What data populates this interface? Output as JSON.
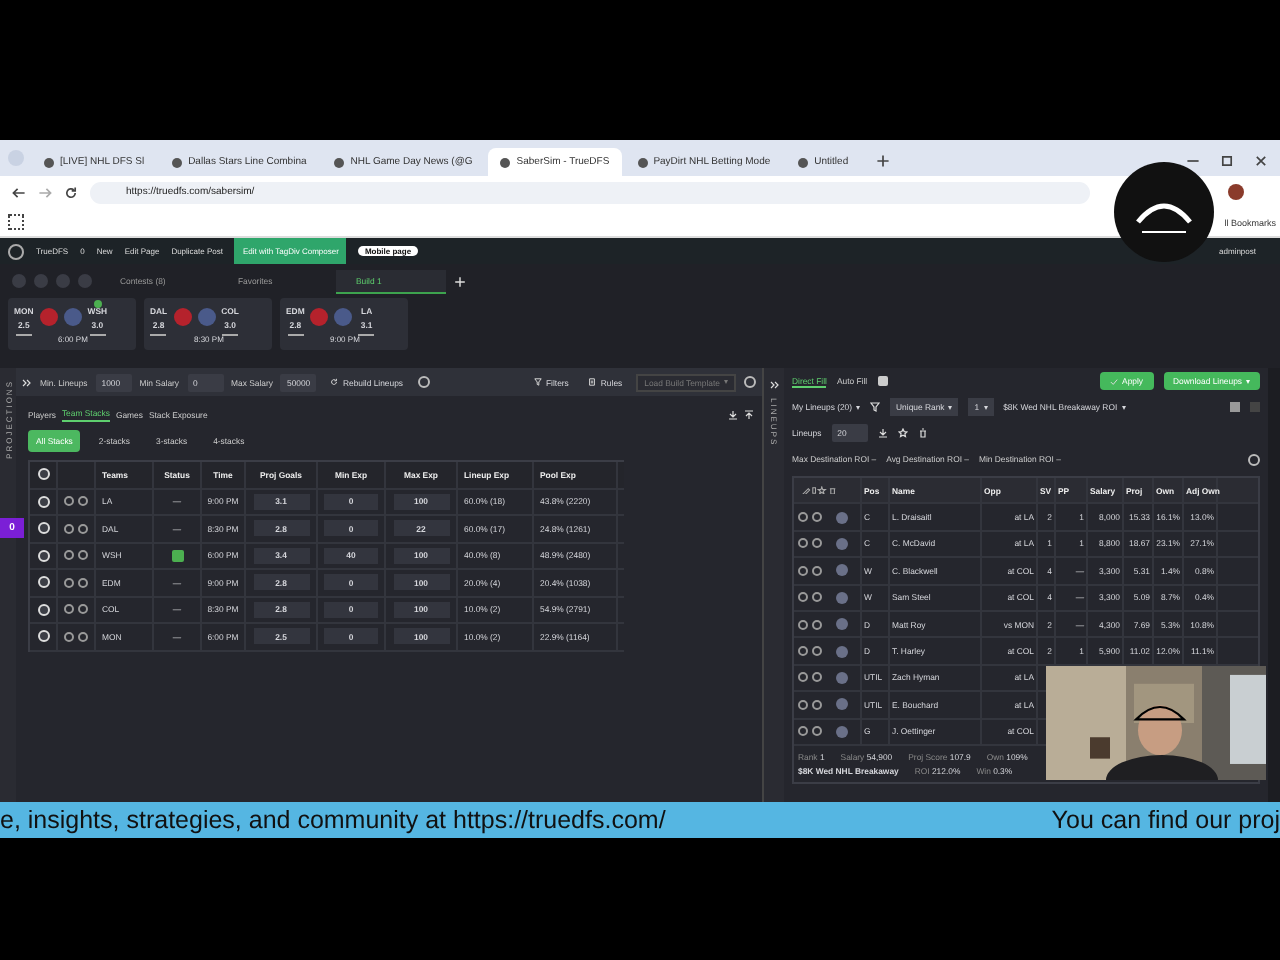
{
  "browser": {
    "tabs": [
      {
        "title": "[LIVE] NHL DFS Sl",
        "selected": false
      },
      {
        "title": "Dallas Stars Line Combina",
        "selected": false
      },
      {
        "title": "NHL Game Day News (@G",
        "selected": false
      },
      {
        "title": "SaberSim - TrueDFS",
        "selected": true
      },
      {
        "title": "PayDirt NHL Betting Mode",
        "selected": false
      },
      {
        "title": "Untitled",
        "selected": false
      }
    ],
    "url": "https://truedfs.com/sabersim/",
    "bookmarks": "ll Bookmarks"
  },
  "wp_bar": {
    "items": [
      {
        "label": "TrueDFS",
        "kind": "plain"
      },
      {
        "label": "0",
        "kind": "plain"
      },
      {
        "label": "New",
        "kind": "plain"
      },
      {
        "label": "Edit Page",
        "kind": "plain"
      },
      {
        "label": "Duplicate Post",
        "kind": "plain"
      },
      {
        "label": "Edit with TagDiv Composer",
        "kind": "composer"
      },
      {
        "label": "Mobile page",
        "kind": "mobile"
      }
    ],
    "user": "adminpost"
  },
  "app": {
    "left_rail": "PROJECTIONS",
    "right_rail": "LINEUPS",
    "side_badge": "0",
    "top_tabs": [
      {
        "label": "Contests (8)",
        "selected": false
      },
      {
        "label": "Favorites",
        "selected": false
      },
      {
        "label": "Build 1",
        "selected": true
      }
    ],
    "games": [
      {
        "away": "MON",
        "away_goals": "2.5",
        "home": "WSH",
        "home_goals": "3.0",
        "time": "6:00 PM",
        "stacked": true
      },
      {
        "away": "DAL",
        "away_goals": "2.8",
        "home": "COL",
        "home_goals": "3.0",
        "time": "8:30 PM",
        "stacked": false
      },
      {
        "away": "EDM",
        "away_goals": "2.8",
        "home": "LA",
        "home_goals": "3.1",
        "time": "9:00 PM",
        "stacked": false
      }
    ],
    "toolbar": {
      "fields": [
        {
          "label": "Min. Lineups",
          "value": "1000"
        },
        {
          "label": "Min Salary",
          "value": "0"
        },
        {
          "label": "Max Salary",
          "value": "50000"
        }
      ],
      "rebuild": "Rebuild Lineups",
      "filters": "Filters",
      "rules": "Rules",
      "template_placeholder": "Load Build Template"
    },
    "subtabs": [
      {
        "label": "Players",
        "selected": false
      },
      {
        "label": "Team Stacks",
        "selected": true
      },
      {
        "label": "Games",
        "selected": false
      },
      {
        "label": "Stack Exposure",
        "selected": false
      }
    ],
    "stack_filters": [
      {
        "label": "All Stacks",
        "selected": true
      },
      {
        "label": "2-stacks",
        "selected": false
      },
      {
        "label": "3-stacks",
        "selected": false
      },
      {
        "label": "4-stacks",
        "selected": false
      }
    ],
    "stacks": {
      "all_checked": true,
      "columns": [
        "Teams",
        "Status",
        "Time",
        "Proj Goals",
        "Min Exp",
        "Max Exp",
        "Lineup Exp",
        "Pool Exp"
      ],
      "rows": [
        {
          "checked": true,
          "team": "LA",
          "locked": false,
          "status": "—",
          "time": "9:00 PM",
          "proj_goals": "3.1",
          "min_exp": "0",
          "max_exp": "100",
          "lineup_exp": "60.0% (18)",
          "pool_exp": "43.8% (2220)"
        },
        {
          "checked": true,
          "team": "DAL",
          "locked": false,
          "status": "—",
          "time": "8:30 PM",
          "proj_goals": "2.8",
          "min_exp": "0",
          "max_exp": "22",
          "lineup_exp": "60.0% (17)",
          "pool_exp": "24.8% (1261)"
        },
        {
          "checked": true,
          "team": "WSH",
          "locked": true,
          "time": "6:00 PM",
          "proj_goals": "3.4",
          "min_exp": "40",
          "max_exp": "100",
          "lineup_exp": "40.0% (8)",
          "pool_exp": "48.9% (2480)"
        },
        {
          "checked": true,
          "team": "EDM",
          "locked": false,
          "status": "—",
          "time": "9:00 PM",
          "proj_goals": "2.8",
          "min_exp": "0",
          "max_exp": "100",
          "lineup_exp": "20.0% (4)",
          "pool_exp": "20.4% (1038)"
        },
        {
          "checked": true,
          "team": "COL",
          "locked": false,
          "status": "—",
          "time": "8:30 PM",
          "proj_goals": "2.8",
          "min_exp": "0",
          "max_exp": "100",
          "lineup_exp": "10.0% (2)",
          "pool_exp": "54.9% (2791)"
        },
        {
          "checked": true,
          "team": "MON",
          "locked": false,
          "status": "—",
          "time": "6:00 PM",
          "proj_goals": "2.5",
          "min_exp": "0",
          "max_exp": "100",
          "lineup_exp": "10.0% (2)",
          "pool_exp": "22.9% (1164)"
        }
      ]
    }
  },
  "lineups": {
    "fill_modes": [
      {
        "label": "Direct Fill",
        "selected": true
      },
      {
        "label": "Auto Fill",
        "selected": false
      }
    ],
    "apply": "Apply",
    "download": "Download Lineups",
    "lineup_set": "My Lineups (20)",
    "sort": "Unique Rank",
    "sort_count": "1",
    "contest": "$8K Wed NHL Breakaway ROI",
    "lineups_label": "Lineups",
    "lineups_value": "20",
    "roi": [
      "Max Destination ROI –",
      "Avg Destination ROI –",
      "Min Destination ROI –"
    ],
    "columns": [
      "Pos",
      "Name",
      "Opp",
      "SV",
      "PP",
      "Salary",
      "Proj",
      "Own",
      "Adj Own"
    ],
    "rows": [
      {
        "pos": "C",
        "name": "L. Draisaitl",
        "opp": "at LA",
        "sv": "2",
        "pp": "1",
        "salary": "8,000",
        "proj": "15.33",
        "own": "16.1%",
        "adj_own": "13.0%"
      },
      {
        "pos": "C",
        "name": "C. McDavid",
        "opp": "at LA",
        "sv": "1",
        "pp": "1",
        "salary": "8,800",
        "proj": "18.67",
        "own": "23.1%",
        "adj_own": "27.1%"
      },
      {
        "pos": "W",
        "name": "C. Blackwell",
        "opp": "at COL",
        "sv": "4",
        "pp": "—",
        "salary": "3,300",
        "proj": "5.31",
        "own": "1.4%",
        "adj_own": "0.8%"
      },
      {
        "pos": "W",
        "name": "Sam Steel",
        "opp": "at COL",
        "sv": "4",
        "pp": "—",
        "salary": "3,300",
        "proj": "5.09",
        "own": "8.7%",
        "adj_own": "0.4%"
      },
      {
        "pos": "D",
        "name": "Matt Roy",
        "opp": "vs MON",
        "sv": "2",
        "pp": "—",
        "salary": "4,300",
        "proj": "7.69",
        "own": "5.3%",
        "adj_own": "10.8%"
      },
      {
        "pos": "D",
        "name": "T. Harley",
        "opp": "at COL",
        "sv": "2",
        "pp": "1",
        "salary": "5,900",
        "proj": "11.02",
        "own": "12.0%",
        "adj_own": "11.1%"
      },
      {
        "pos": "UTIL",
        "name": "Zach Hyman",
        "opp": "at LA"
      },
      {
        "pos": "UTIL",
        "name": "E. Bouchard",
        "opp": "at LA"
      },
      {
        "pos": "G",
        "name": "J. Oettinger",
        "opp": "at COL"
      }
    ],
    "footer": [
      {
        "label": "Rank",
        "value": "1"
      },
      {
        "label": "Salary",
        "value": "54,900"
      },
      {
        "label": "Proj Score",
        "value": "107.9"
      },
      {
        "label": "Own",
        "value": "109%"
      }
    ],
    "contest_name": "$8K Wed NHL Breakaway",
    "footer2": [
      {
        "label": "ROI",
        "value": "212.0%"
      },
      {
        "label": "Win",
        "value": "0.3%"
      }
    ]
  },
  "banner": [
    "e, insights, strategies, and community at https://truedfs.com/",
    "You can find our proj"
  ]
}
